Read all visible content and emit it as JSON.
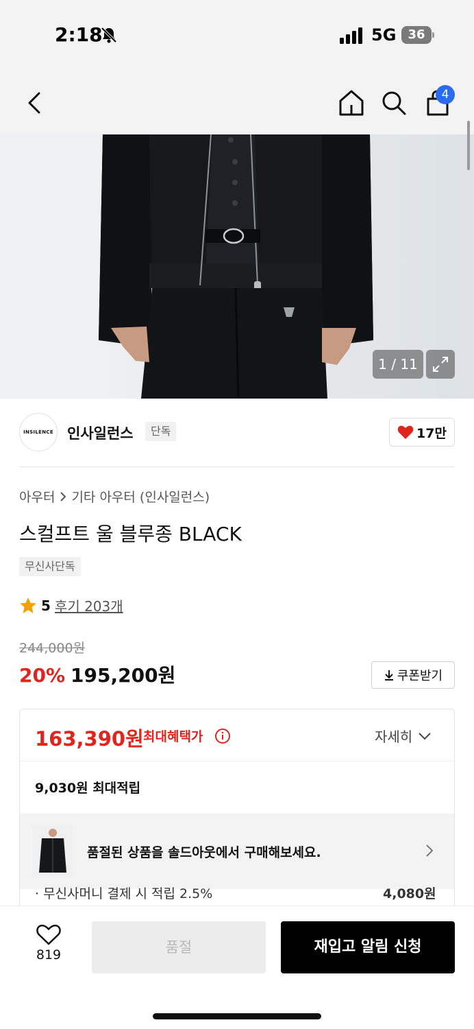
{
  "status_bar": {
    "time": "2:18",
    "network": "5G",
    "battery": "36"
  },
  "nav": {
    "cart_count": "4"
  },
  "gallery": {
    "counter": "1 / 11"
  },
  "brand": {
    "logo_text": "INSILENCE",
    "name": "인사일런스",
    "tag": "단독",
    "likes": "17만"
  },
  "product": {
    "breadcrumb": [
      "아우터",
      "기타 아우터 (인사일런스)"
    ],
    "title": "스컬프트 울 블루종 BLACK",
    "tag": "무신사단독",
    "rating": "5",
    "reviews": "후기 203개",
    "original_price": "244,000원",
    "discount": "20%",
    "sale_price": "195,200원",
    "coupon_label": "쿠폰받기"
  },
  "benefit": {
    "max_price": "163,390원",
    "max_label": "최대혜택가",
    "detail_label": "자세히",
    "points": "9,030원 최대적립",
    "soldout_banner": "품절된 상품을 솔드아웃에서 구매해보세요.",
    "partial_left": "· 무신사머니 결제 시 적립 2.5%",
    "partial_right": "4,080원"
  },
  "bottom": {
    "wish_count": "819",
    "soldout_label": "품절",
    "restock_label": "재입고 알림 신청"
  },
  "colors": {
    "accent_red": "#e0261c",
    "badge_blue": "#2a6bf2"
  }
}
